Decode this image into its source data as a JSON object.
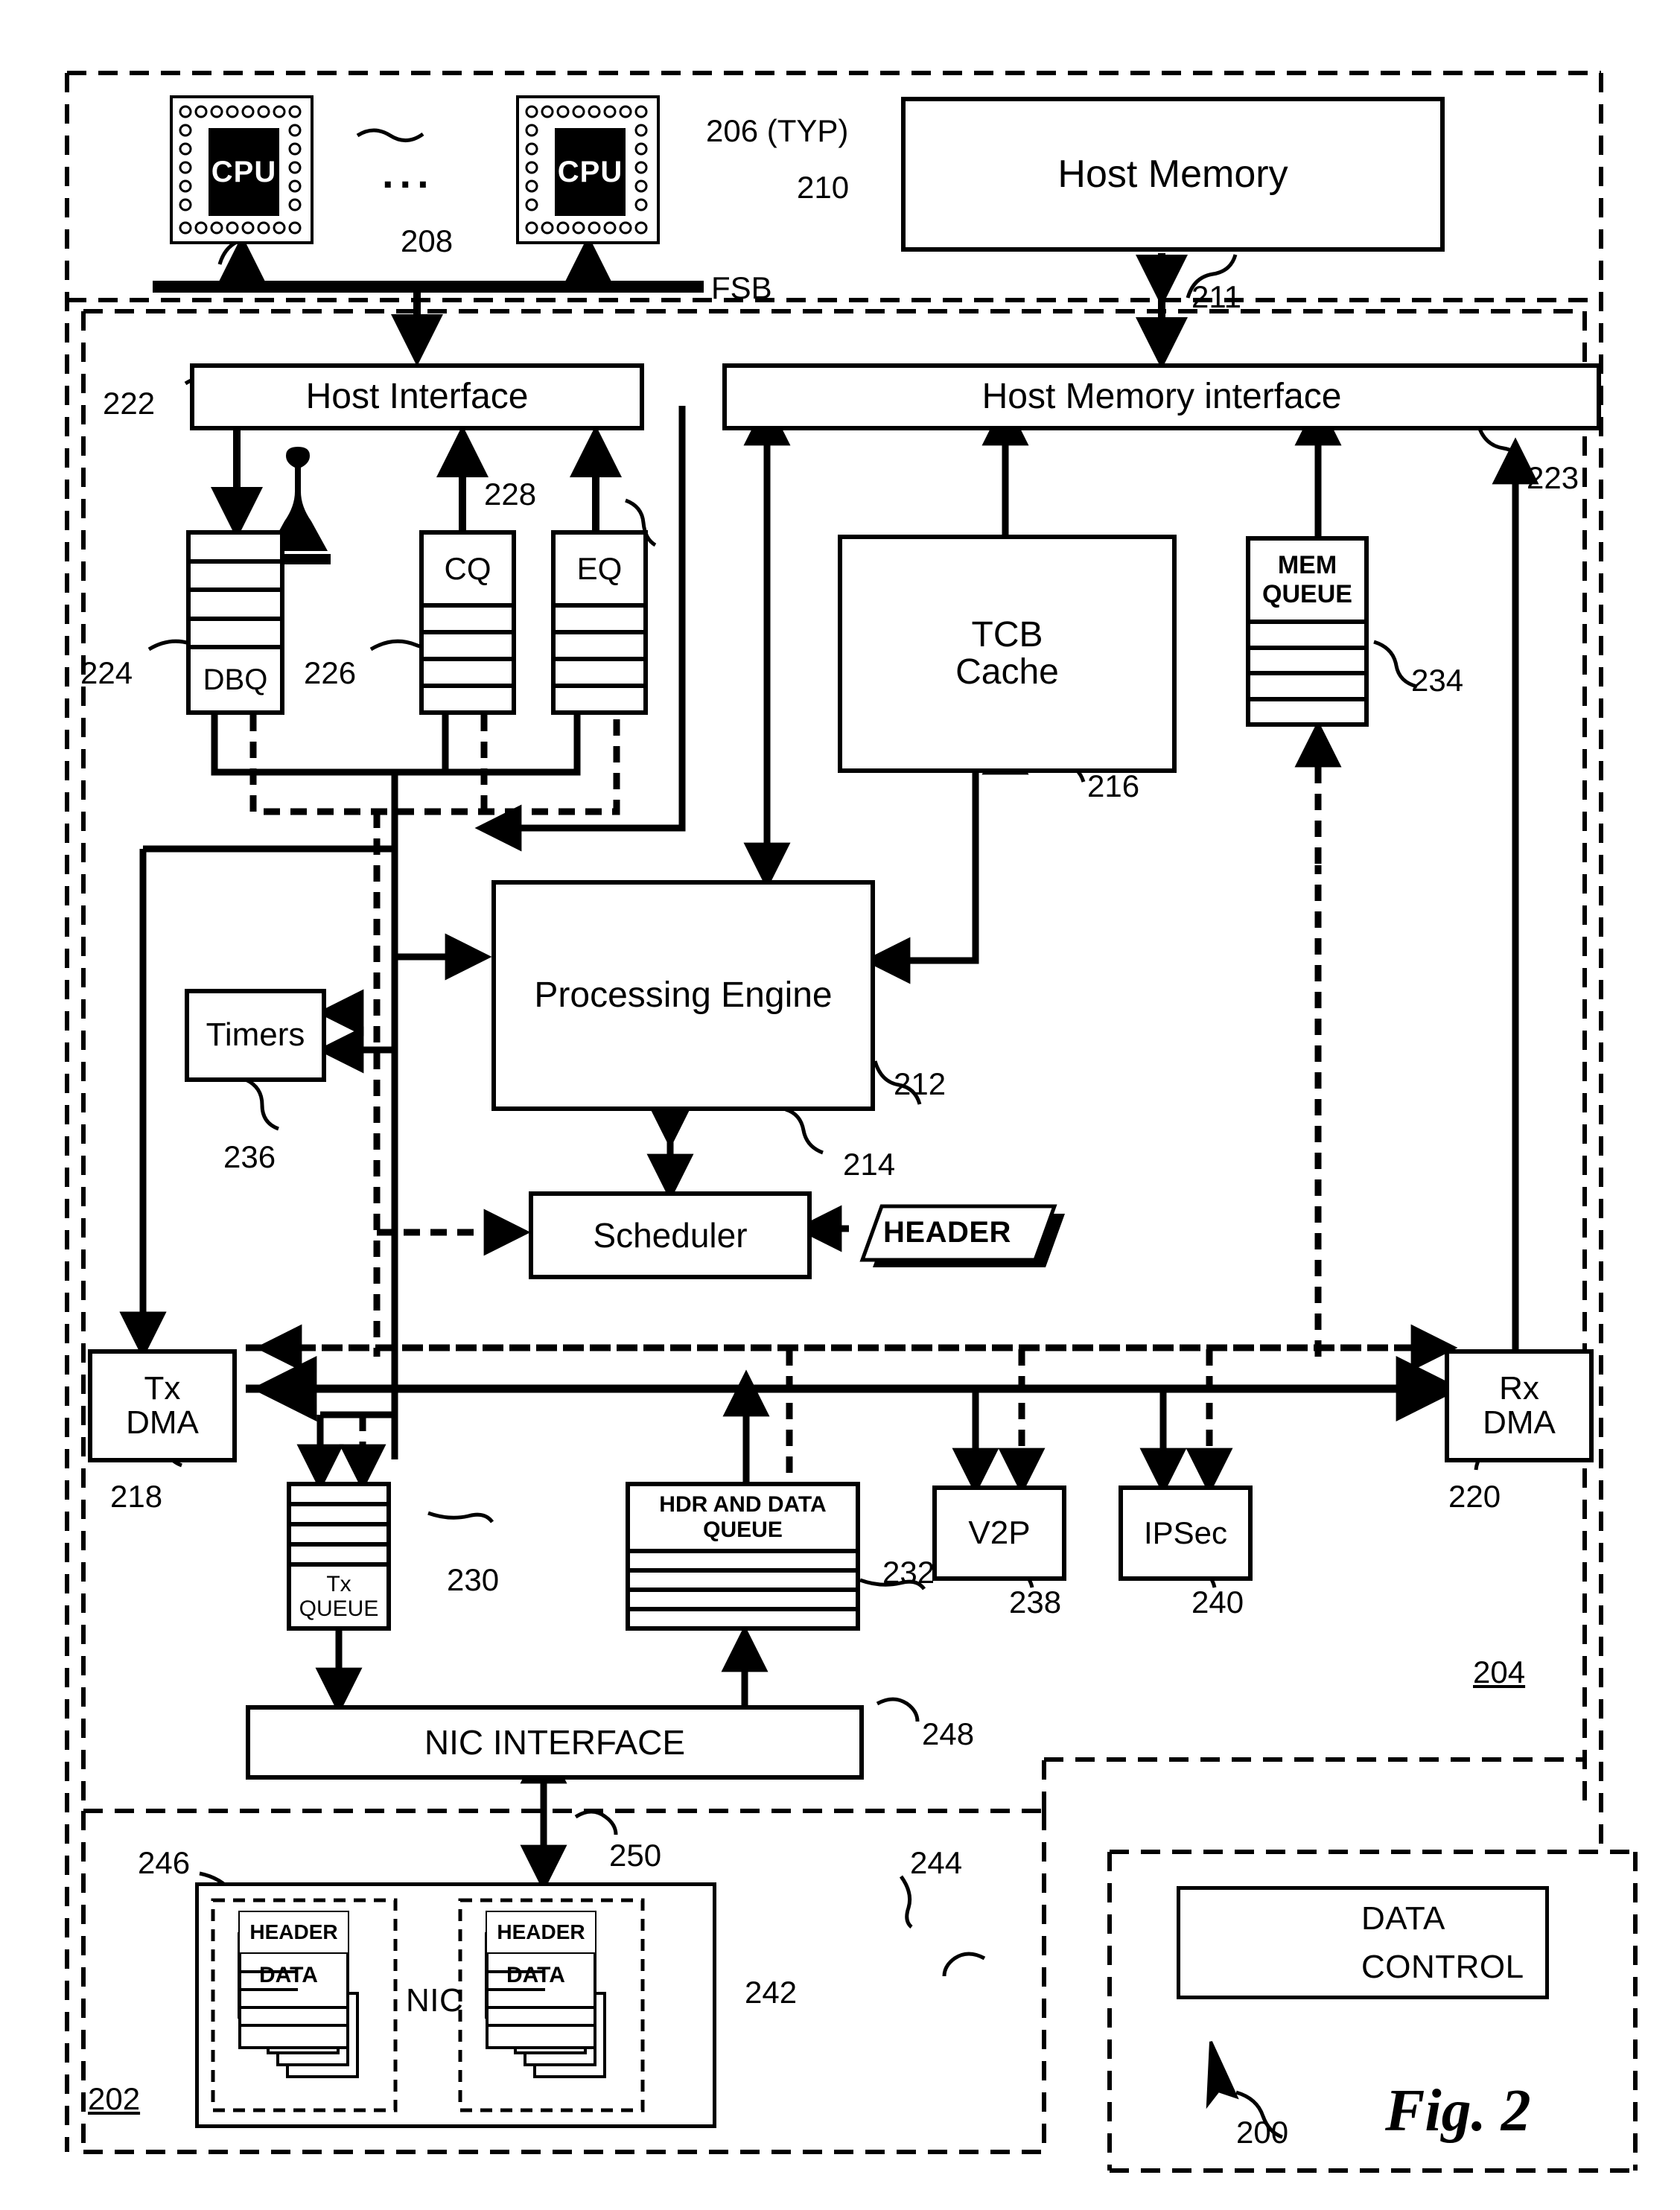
{
  "figure": {
    "label": "Fig. 2",
    "system_ref": "200"
  },
  "host": {
    "cpu_label": "CPU",
    "cpu_ellipsis": "...",
    "cpu_ref": "206 (TYP)",
    "bus_label": "FSB",
    "bus_ref": "208",
    "host_memory": "Host Memory",
    "host_memory_ref": "210",
    "memory_link_ref": "211"
  },
  "adapter": {
    "ref": "204",
    "host_interface": "Host Interface",
    "host_interface_ref": "222",
    "host_memory_interface": "Host Memory interface",
    "host_memory_interface_ref": "223",
    "dbq": "DBQ",
    "dbq_ref": "224",
    "cq": "CQ",
    "cq_ref": "226",
    "eq": "EQ",
    "eq_ref": "228",
    "tcb_cache_line1": "TCB",
    "tcb_cache_line2": "Cache",
    "tcb_cache_ref": "216",
    "mem_queue_line1": "MEM",
    "mem_queue_line2": "QUEUE",
    "mem_queue_ref": "234",
    "processing_engine": "Processing Engine",
    "processing_engine_ref": "212",
    "timers": "Timers",
    "timers_ref": "236",
    "scheduler": "Scheduler",
    "scheduler_ref": "214",
    "header_tag": "HEADER",
    "tx_dma_line1": "Tx",
    "tx_dma_line2": "DMA",
    "tx_dma_ref": "218",
    "rx_dma_line1": "Rx",
    "rx_dma_line2": "DMA",
    "rx_dma_ref": "220",
    "tx_queue_line1": "Tx",
    "tx_queue_line2": "QUEUE",
    "tx_queue_ref": "230",
    "hdr_data_queue_line1": "HDR AND DATA",
    "hdr_data_queue_line2": "QUEUE",
    "hdr_data_queue_ref": "232",
    "v2p": "V2P",
    "v2p_ref": "238",
    "ipsec": "IPSec",
    "ipsec_ref": "240",
    "nic_interface": "NIC INTERFACE",
    "nic_interface_ref": "248"
  },
  "nic": {
    "ref": "202",
    "nic_label": "NIC",
    "nic_block_ref": "242",
    "tx_stack_ref": "246",
    "rx_stack_ref": "244",
    "link_ref": "250",
    "packet_header": "HEADER",
    "packet_data": "DATA"
  },
  "legend": {
    "data": "DATA",
    "control": "CONTROL"
  }
}
